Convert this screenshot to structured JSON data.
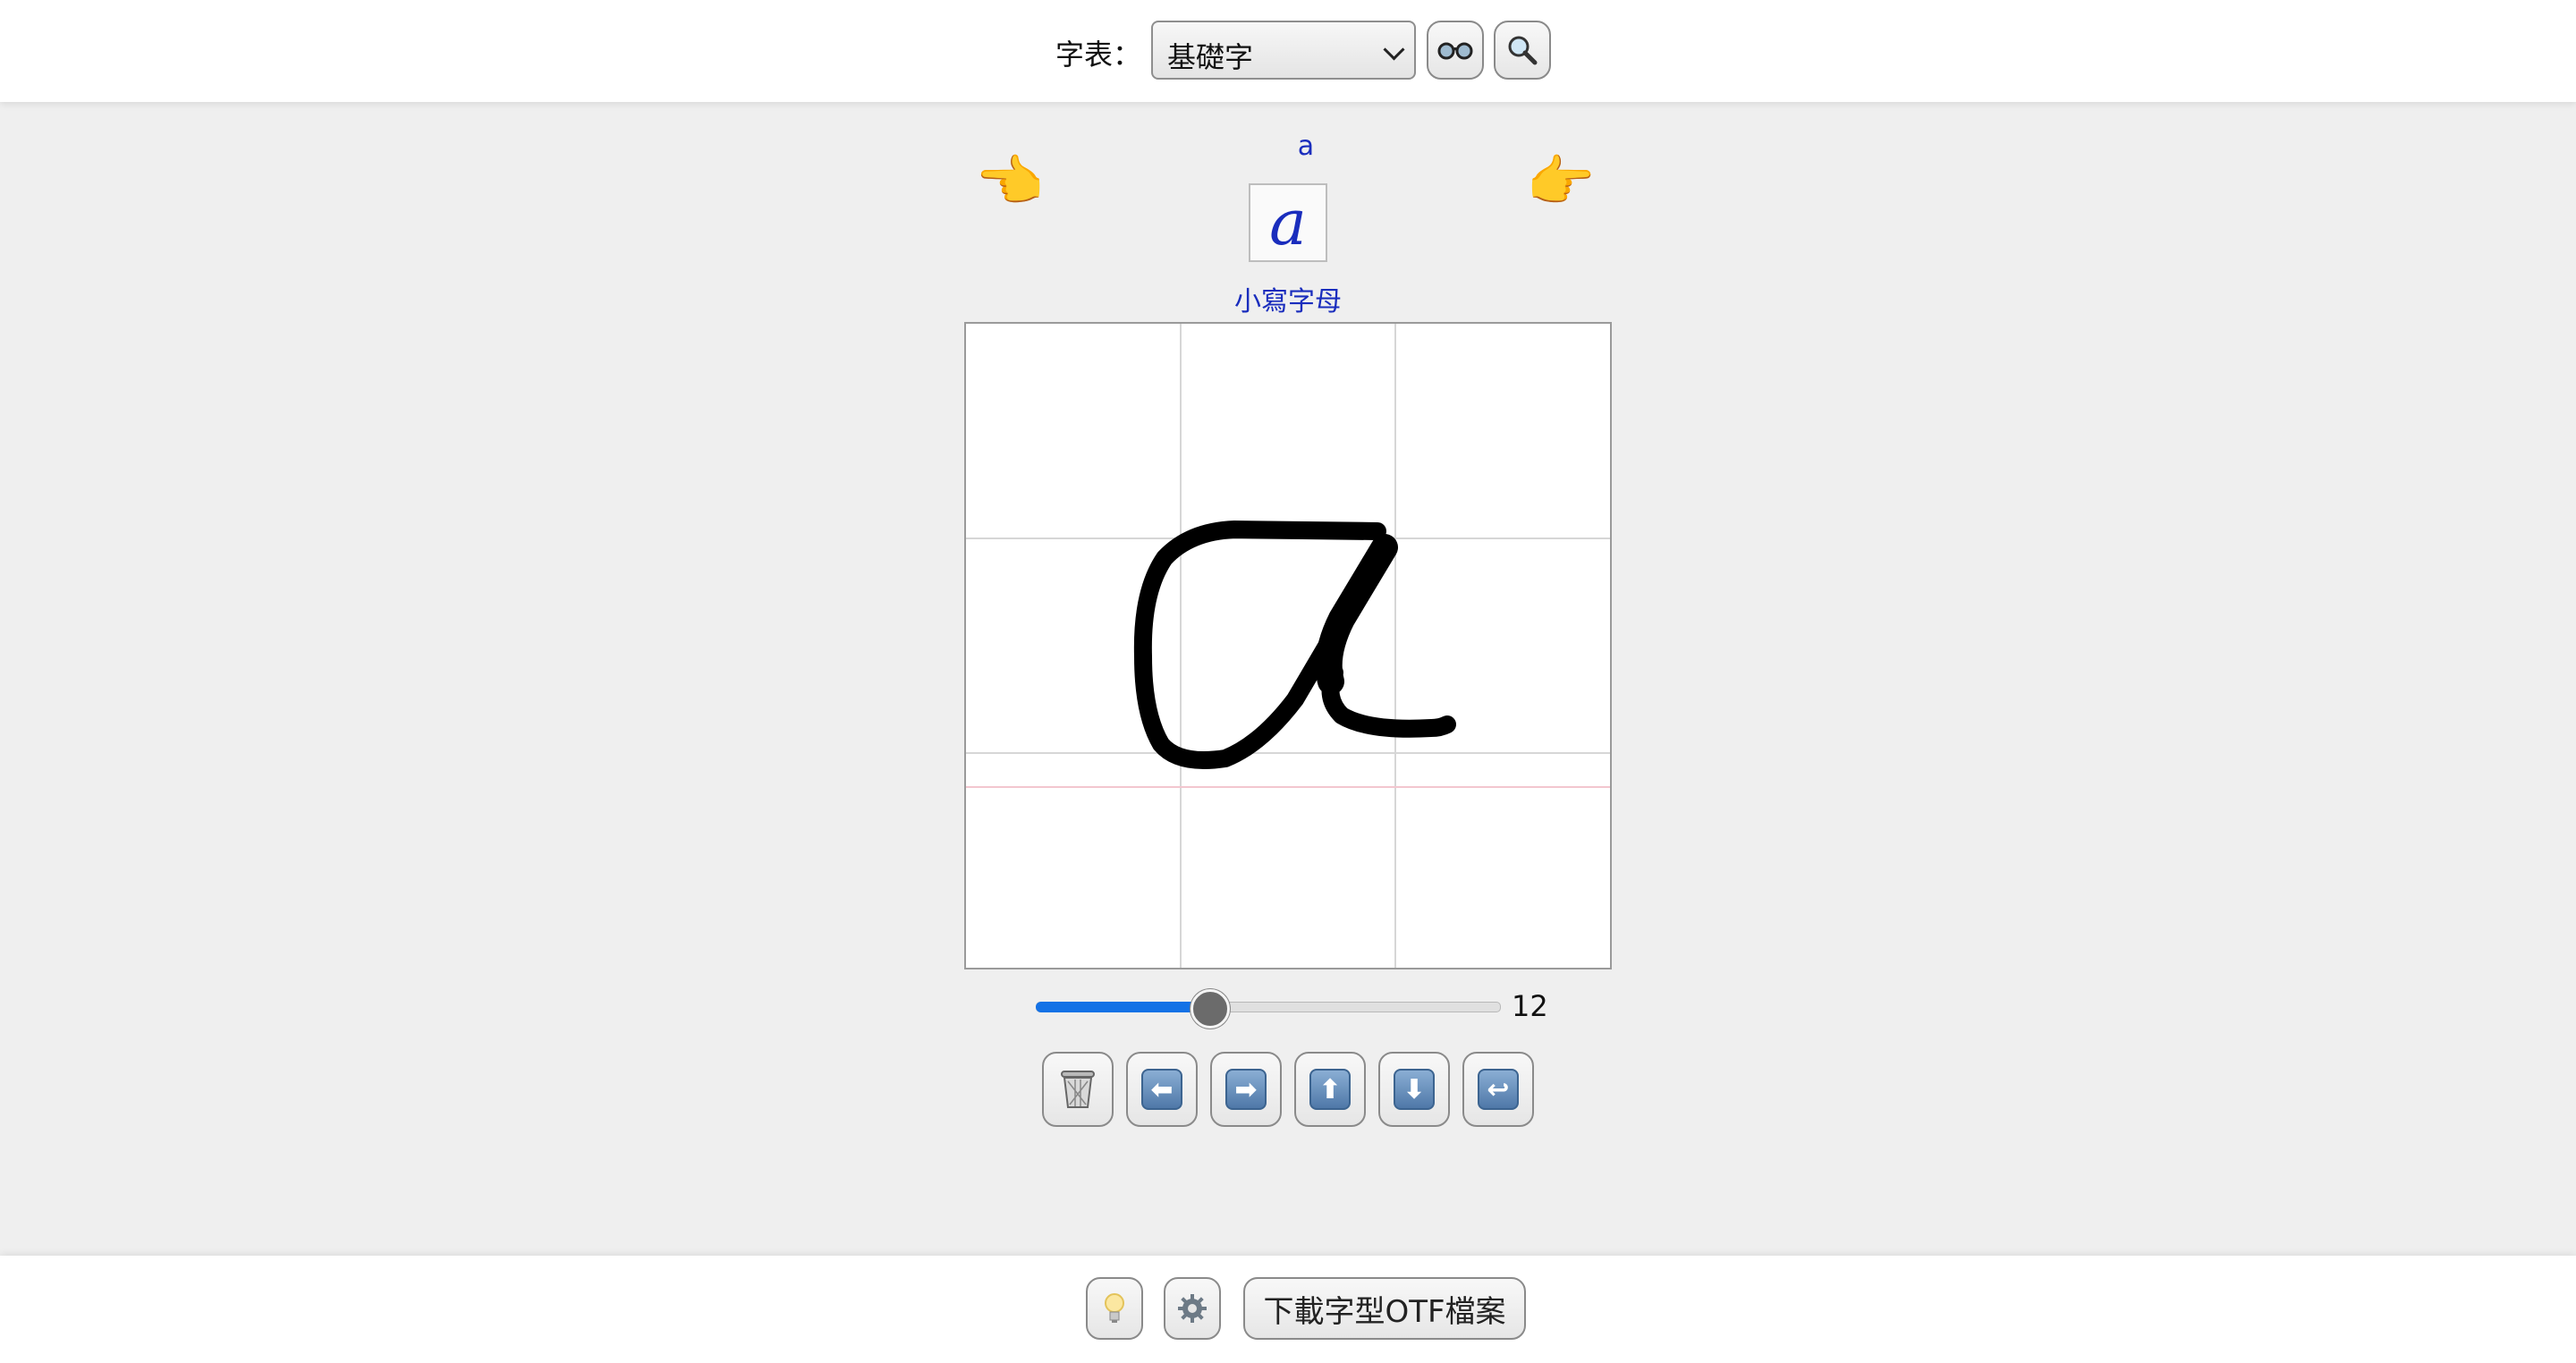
{
  "toolbar": {
    "table_label": "字表：",
    "table_select_value": "基礎字",
    "icons": {
      "view": "glasses-icon",
      "search": "magnifier-icon"
    }
  },
  "character": {
    "romanization": "a",
    "glyph": "a",
    "category": "小寫字母",
    "icons": {
      "prev": "hand-pointing-left-icon",
      "next": "hand-pointing-right-icon"
    }
  },
  "pen_width": {
    "value": "12",
    "fraction": 0.37
  },
  "tools": [
    {
      "name": "trash",
      "icon": "wastebasket-icon"
    },
    {
      "name": "left",
      "icon": "arrow-left-icon"
    },
    {
      "name": "right",
      "icon": "arrow-right-icon"
    },
    {
      "name": "up",
      "icon": "arrow-up-icon"
    },
    {
      "name": "down",
      "icon": "arrow-down-icon"
    },
    {
      "name": "undo",
      "icon": "undo-icon"
    }
  ],
  "footer": {
    "download_label": "下載字型OTF檔案",
    "icons": {
      "hint": "light-bulb-icon",
      "settings": "gear-icon"
    }
  },
  "colors": {
    "accent_blue": "#1a2dbd",
    "slider_fill": "#1472e6",
    "baseline_pink": "#f3c6cf"
  }
}
